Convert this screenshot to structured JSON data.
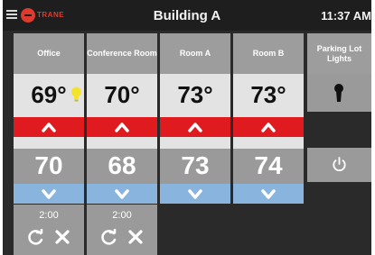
{
  "header": {
    "brand": "TRANE",
    "title": "Building A",
    "time": "11:37 AM"
  },
  "zones": [
    {
      "name": "Office",
      "current": "69°",
      "setpoint": "70",
      "hold_time": "2:00",
      "occupied_icon": "lightbulb-icon"
    },
    {
      "name": "Conference Room",
      "current": "70°",
      "setpoint": "68",
      "hold_time": "2:00"
    },
    {
      "name": "Room A",
      "current": "73°",
      "setpoint": "73"
    },
    {
      "name": "Room B",
      "current": "73°",
      "setpoint": "74"
    }
  ],
  "lights": {
    "name": "Parking Lot Lights",
    "state_icon": "keyhole-icon",
    "button_icon": "power-icon"
  },
  "colors": {
    "background": "#2a2a2a",
    "header_tile": "#9d9d9d",
    "temp_tile": "#e3e3e3",
    "up_red": "#e01b20",
    "down_blue": "#88b4dd",
    "brand_red": "#e03a2f",
    "bulb_yellow": "#f5e22a"
  },
  "icons": {
    "menu": "hamburger-menu-icon",
    "up": "chevron-up-icon",
    "down": "chevron-down-icon",
    "resume": "resume-schedule-icon",
    "cancel": "cancel-hold-icon"
  }
}
